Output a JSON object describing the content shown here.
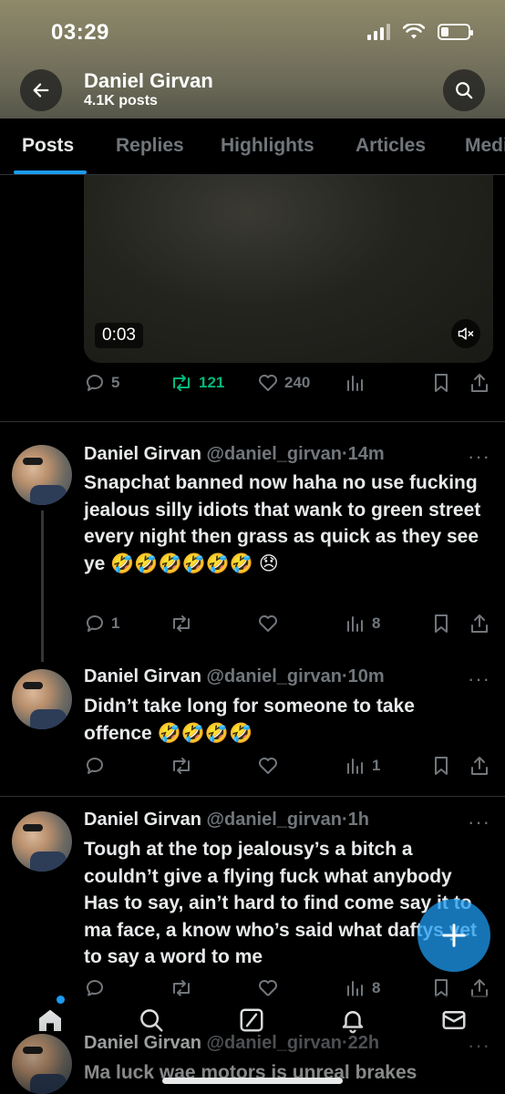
{
  "status_bar": {
    "time": "03:29"
  },
  "header": {
    "name": "Daniel Girvan",
    "posts": "4.1K posts"
  },
  "tabs": [
    {
      "label": "Posts",
      "active": true
    },
    {
      "label": "Replies"
    },
    {
      "label": "Highlights"
    },
    {
      "label": "Articles"
    },
    {
      "label": "Media"
    }
  ],
  "video_post": {
    "duration": "0:03",
    "replies": "5",
    "reposts": "121",
    "likes": "240"
  },
  "tweets": [
    {
      "name": "Daniel Girvan",
      "handle": "@daniel_girvan",
      "time": "14m",
      "text": "Snapchat banned now haha no use fucking jealous silly idiots that wank to green street every night then grass as quick as they see ye 🤣🤣🤣🤣🤣🤣 😞",
      "replies": "1",
      "views": "8"
    },
    {
      "name": "Daniel Girvan",
      "handle": "@daniel_girvan",
      "time": "10m",
      "text": "Didn’t take long for someone to take offence 🤣🤣🤣🤣",
      "views": "1"
    },
    {
      "name": "Daniel Girvan",
      "handle": "@daniel_girvan",
      "time": "1h",
      "text": "Tough at the top jealousy’s a bitch a couldn’t give a flying fuck what anybody Has to say, ain’t hard to find come say it to ma face, a know who’s said what daftys yet to say a word to me",
      "views": "8"
    },
    {
      "name": "Daniel Girvan",
      "handle": "@daniel_girvan",
      "time": "22h",
      "text": "Ma luck wae motors is unreal brakes"
    }
  ],
  "colors": {
    "accent": "#1d9bf0",
    "repost_active": "#00ba7c",
    "muted": "#71767b"
  },
  "icons": {
    "back": "arrow-left-icon",
    "search": "search-icon",
    "mute": "volume-mute-icon",
    "reply": "speech-bubble-icon",
    "repost": "repost-arrows-icon",
    "like": "heart-icon",
    "views": "bar-chart-icon",
    "bookmark": "bookmark-icon",
    "share": "share-upload-icon",
    "compose": "plus-icon",
    "nav": [
      "home-icon",
      "search-icon",
      "grok-icon",
      "bell-icon",
      "mail-icon"
    ]
  }
}
